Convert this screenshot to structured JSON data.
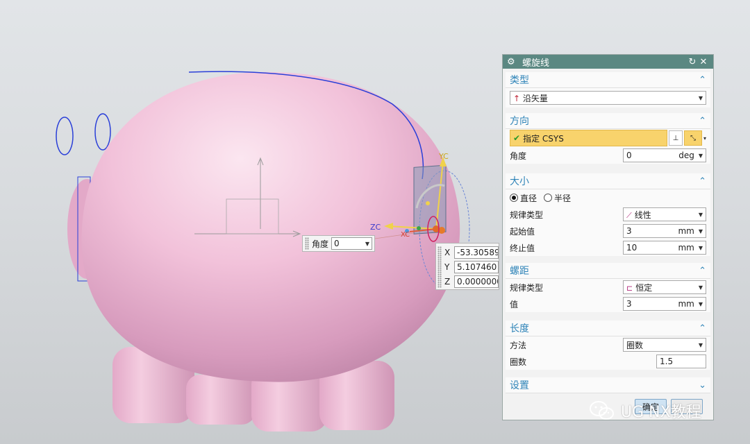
{
  "dialog": {
    "title": "螺旋线",
    "sections": {
      "type": {
        "header": "类型",
        "value": "沿矢量"
      },
      "direction": {
        "header": "方向",
        "csys_label": "指定 CSYS",
        "angle_label": "角度",
        "angle_value": "0",
        "angle_unit": "deg"
      },
      "size": {
        "header": "大小",
        "radio_diameter": "直径",
        "radio_radius": "半径",
        "law_type_label": "规律类型",
        "law_type_value": "线性",
        "start_label": "起始值",
        "start_value": "3",
        "start_unit": "mm",
        "end_label": "终止值",
        "end_value": "10",
        "end_unit": "mm"
      },
      "pitch": {
        "header": "螺距",
        "law_type_label": "规律类型",
        "law_type_value": "恒定",
        "value_label": "值",
        "value": "3",
        "unit": "mm"
      },
      "length": {
        "header": "长度",
        "method_label": "方法",
        "method_value": "圈数",
        "turns_label": "圈数",
        "turns_value": "1.5"
      },
      "settings": {
        "header": "设置"
      }
    },
    "ok_label": "确定"
  },
  "viewport": {
    "float_angle": {
      "label": "角度",
      "value": "0"
    },
    "float_xyz": {
      "x": "-53.30589",
      "y": "5.107460",
      "z": "0.0000000"
    },
    "axis_labels": {
      "yc": "YC",
      "zc": "ZC",
      "xc": "XC"
    }
  },
  "watermark": {
    "text": "UG NX教程"
  },
  "colors": {
    "body": "#f2c2da",
    "title_bar": "#5b8882",
    "section_header": "#2f84b8",
    "csys_highlight": "#f8d36c",
    "curve": "#2a3fd8"
  }
}
